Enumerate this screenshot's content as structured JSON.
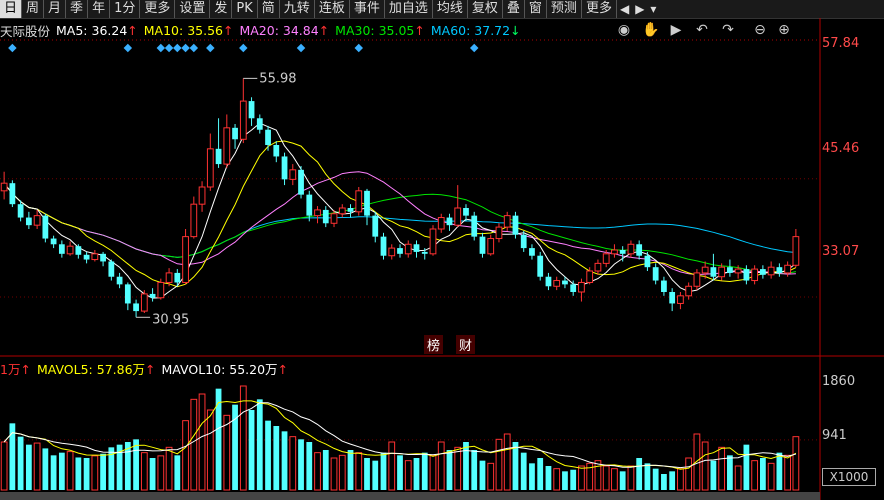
{
  "toolbar": {
    "items": [
      "日",
      "周",
      "月",
      "季",
      "年",
      "1分",
      "更多",
      "设置",
      "发",
      "PK",
      "简",
      "九转",
      "连板",
      "事件",
      "加自选",
      "均线",
      "复权",
      "叠",
      "窗",
      "预测",
      "更多"
    ],
    "nav_prev": "◀",
    "nav_next": "▶",
    "menu": "▾"
  },
  "ma_legend": {
    "name": "天际股份",
    "ma5": "MA5: 36.24",
    "ma5_arrow": "↑",
    "ma10": "MA10: 35.56",
    "ma10_arrow": "↑",
    "ma20": "MA20: 34.84",
    "ma20_arrow": "↑",
    "ma30": "MA30: 35.05",
    "ma30_arrow": "↑",
    "ma60": "MA60: 37.72",
    "ma60_arrow": "↓"
  },
  "controls": {
    "eye": "◉",
    "hand": "✋",
    "play": "▶",
    "undo": "↶",
    "redo": "↷",
    "minus": "⊖",
    "plus": "⊕"
  },
  "price_axis": [
    "57.84",
    "45.46",
    "33.07"
  ],
  "annotations": {
    "high": "55.98",
    "low": "30.95",
    "tag1": "榜",
    "tag2": "财"
  },
  "volume_legend": {
    "vol_arrow_prefix": "1万",
    "vol_arrow": "↑",
    "mavol5": "MAVOL5: 57.86万",
    "mavol5_arrow": "↑",
    "mavol10": "MAVOL10: 55.20万",
    "mavol10_arrow": "↑"
  },
  "volume_axis": [
    "1860",
    "941"
  ],
  "volume_unit": "X1000",
  "colors": {
    "up": "#ff3232",
    "down": "#54ffff",
    "ma5": "#ffffff",
    "ma10": "#ffff00",
    "ma20": "#ff80ff",
    "ma30": "#00e600",
    "ma60": "#00c8ff",
    "markers": "#3ab0ff"
  },
  "chart_data": {
    "type": "candlestick",
    "ylim": [
      27,
      60
    ],
    "volume_ylim": [
      0,
      2100
    ],
    "candles": [
      [
        44.2,
        45.0,
        46.2,
        43.3
      ],
      [
        45.0,
        42.8,
        45.3,
        42.5
      ],
      [
        42.8,
        41.4,
        43.2,
        41.0
      ],
      [
        41.4,
        40.6,
        42.0,
        40.2
      ],
      [
        40.6,
        41.6,
        42.2,
        40.2
      ],
      [
        41.6,
        39.2,
        41.8,
        38.8
      ],
      [
        39.2,
        38.6,
        39.5,
        38.2
      ],
      [
        38.6,
        37.6,
        39.0,
        37.2
      ],
      [
        37.6,
        38.4,
        38.9,
        37.4
      ],
      [
        38.4,
        37.5,
        38.6,
        37.1
      ],
      [
        37.5,
        37.0,
        37.8,
        36.6
      ],
      [
        37.0,
        37.6,
        38.0,
        36.8
      ],
      [
        37.6,
        36.8,
        37.8,
        36.3
      ],
      [
        36.8,
        35.2,
        37.0,
        34.8
      ],
      [
        35.2,
        34.4,
        35.6,
        34.0
      ],
      [
        34.4,
        32.4,
        34.6,
        31.7
      ],
      [
        32.4,
        31.6,
        32.8,
        30.95
      ],
      [
        31.6,
        33.4,
        33.8,
        31.4
      ],
      [
        33.4,
        33.0,
        34.0,
        32.6
      ],
      [
        33.0,
        34.6,
        35.0,
        32.8
      ],
      [
        34.6,
        35.6,
        36.1,
        34.2
      ],
      [
        35.6,
        34.6,
        36.0,
        34.2
      ],
      [
        34.6,
        39.4,
        40.2,
        34.4
      ],
      [
        39.4,
        42.8,
        43.6,
        39.2
      ],
      [
        42.8,
        44.6,
        45.2,
        42.0
      ],
      [
        44.6,
        48.6,
        50.2,
        44.2
      ],
      [
        48.6,
        47.0,
        51.8,
        46.6
      ],
      [
        47.0,
        50.8,
        52.2,
        46.6
      ],
      [
        50.8,
        49.6,
        51.2,
        48.6
      ],
      [
        49.6,
        53.6,
        55.98,
        49.2
      ],
      [
        53.6,
        51.8,
        54.0,
        51.0
      ],
      [
        51.8,
        50.6,
        52.2,
        50.2
      ],
      [
        50.6,
        49.0,
        51.0,
        48.4
      ],
      [
        49.0,
        47.8,
        49.4,
        47.2
      ],
      [
        47.8,
        45.4,
        48.2,
        44.8
      ],
      [
        45.4,
        46.4,
        47.0,
        44.8
      ],
      [
        46.4,
        43.8,
        46.8,
        43.4
      ],
      [
        43.8,
        41.6,
        44.2,
        41.0
      ],
      [
        41.6,
        42.2,
        42.6,
        40.8
      ],
      [
        42.2,
        40.8,
        42.6,
        40.4
      ],
      [
        40.8,
        41.8,
        42.2,
        40.4
      ],
      [
        41.8,
        42.4,
        42.8,
        41.4
      ],
      [
        42.4,
        42.0,
        42.8,
        41.4
      ],
      [
        42.0,
        44.2,
        44.6,
        41.6
      ],
      [
        44.2,
        41.6,
        44.4,
        40.6
      ],
      [
        41.6,
        39.4,
        42.0,
        38.8
      ],
      [
        39.4,
        37.4,
        39.8,
        37.0
      ],
      [
        37.4,
        38.2,
        38.6,
        37.0
      ],
      [
        38.2,
        37.6,
        38.6,
        37.2
      ],
      [
        37.6,
        38.6,
        39.0,
        37.2
      ],
      [
        38.6,
        37.8,
        39.0,
        37.2
      ],
      [
        37.8,
        37.6,
        38.2,
        37.0
      ],
      [
        37.6,
        40.2,
        40.6,
        37.4
      ],
      [
        40.2,
        41.4,
        41.8,
        39.8
      ],
      [
        41.4,
        40.6,
        41.8,
        40.0
      ],
      [
        40.6,
        42.4,
        44.8,
        40.4
      ],
      [
        42.4,
        41.6,
        42.8,
        41.0
      ],
      [
        41.6,
        39.4,
        42.0,
        39.0
      ],
      [
        39.4,
        37.6,
        39.8,
        37.2
      ],
      [
        37.6,
        39.2,
        39.6,
        37.4
      ],
      [
        39.2,
        40.4,
        40.8,
        38.8
      ],
      [
        40.4,
        41.6,
        42.0,
        40.0
      ],
      [
        41.6,
        39.6,
        42.0,
        39.2
      ],
      [
        39.6,
        38.2,
        40.0,
        37.8
      ],
      [
        38.2,
        37.4,
        38.6,
        37.0
      ],
      [
        37.4,
        35.2,
        37.8,
        34.8
      ],
      [
        35.2,
        34.2,
        35.6,
        33.8
      ],
      [
        34.2,
        34.8,
        35.2,
        33.8
      ],
      [
        34.8,
        34.4,
        35.2,
        34.0
      ],
      [
        34.4,
        33.6,
        34.8,
        33.2
      ],
      [
        33.6,
        34.6,
        35.0,
        32.6
      ],
      [
        34.6,
        35.8,
        36.2,
        34.4
      ],
      [
        35.8,
        36.6,
        37.0,
        35.4
      ],
      [
        36.6,
        37.6,
        38.0,
        36.2
      ],
      [
        37.6,
        38.0,
        38.6,
        37.2
      ],
      [
        38.0,
        37.6,
        38.4,
        36.8
      ],
      [
        37.6,
        38.6,
        39.0,
        37.2
      ],
      [
        38.6,
        37.4,
        39.0,
        37.0
      ],
      [
        37.4,
        36.2,
        37.8,
        35.8
      ],
      [
        36.2,
        34.8,
        36.6,
        34.4
      ],
      [
        34.8,
        33.6,
        35.2,
        33.2
      ],
      [
        33.6,
        32.4,
        34.0,
        31.6
      ],
      [
        32.4,
        33.2,
        33.6,
        31.8
      ],
      [
        33.2,
        34.2,
        34.6,
        32.8
      ],
      [
        34.2,
        35.6,
        36.0,
        33.8
      ],
      [
        35.6,
        36.2,
        36.8,
        35.0
      ],
      [
        36.2,
        35.2,
        37.6,
        34.8
      ],
      [
        35.2,
        36.2,
        36.6,
        34.8
      ],
      [
        36.2,
        35.6,
        37.0,
        35.2
      ],
      [
        35.6,
        36.0,
        36.4,
        35.0
      ],
      [
        36.0,
        34.8,
        36.4,
        34.4
      ],
      [
        34.8,
        36.0,
        36.4,
        34.4
      ],
      [
        36.0,
        35.4,
        36.4,
        35.0
      ],
      [
        35.4,
        36.2,
        36.8,
        35.0
      ],
      [
        36.2,
        35.6,
        36.6,
        35.2
      ],
      [
        35.6,
        36.4,
        36.8,
        35.2
      ],
      [
        36.4,
        39.4,
        40.2,
        36.2
      ]
    ],
    "volume": [
      900,
      1250,
      1000,
      850,
      880,
      780,
      650,
      700,
      720,
      610,
      600,
      640,
      680,
      800,
      850,
      900,
      950,
      700,
      600,
      640,
      800,
      650,
      1300,
      1700,
      1800,
      1500,
      1900,
      1400,
      1600,
      1950,
      1500,
      1700,
      1300,
      1200,
      1100,
      1000,
      950,
      900,
      700,
      750,
      600,
      650,
      750,
      700,
      600,
      550,
      700,
      900,
      650,
      550,
      600,
      700,
      650,
      900,
      750,
      800,
      900,
      750,
      550,
      500,
      950,
      1050,
      900,
      700,
      500,
      600,
      450,
      400,
      350,
      380,
      450,
      500,
      550,
      450,
      400,
      350,
      450,
      600,
      500,
      400,
      300,
      350,
      400,
      600,
      1050,
      900,
      550,
      800,
      650,
      450,
      850,
      550,
      600,
      500,
      700,
      650,
      1000
    ]
  }
}
